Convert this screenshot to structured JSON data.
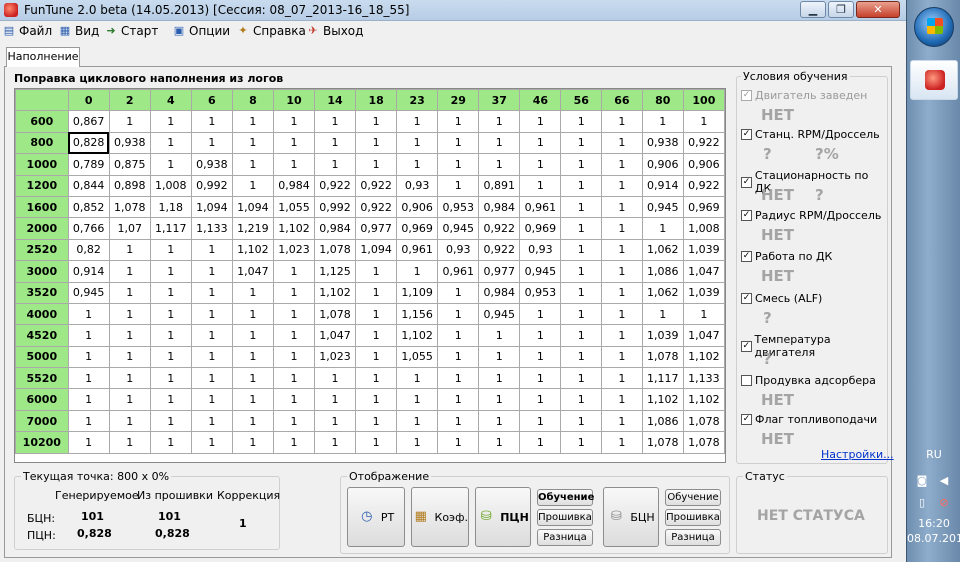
{
  "window": {
    "title": "FunTune 2.0 beta (14.05.2013) [Сессия: 08_07_2013-16_18_55]",
    "min": "▁",
    "max": "❐",
    "close": "✕"
  },
  "menu": [
    {
      "label": "Файл",
      "icon": "file-icon"
    },
    {
      "label": "Вид",
      "icon": "view-icon"
    },
    {
      "label": "Старт",
      "icon": "start-icon"
    },
    {
      "label": "Опции",
      "icon": "options-icon"
    },
    {
      "label": "Справка",
      "icon": "help-icon"
    },
    {
      "label": "Выход",
      "icon": "exit-icon"
    }
  ],
  "tab": "Наполнение",
  "grid": {
    "title": "Поправка циклового наполнения из логов",
    "columns": [
      "0",
      "2",
      "4",
      "6",
      "8",
      "10",
      "14",
      "18",
      "23",
      "29",
      "37",
      "46",
      "56",
      "66",
      "80",
      "100"
    ],
    "rows": [
      {
        "rpm": "600",
        "v": [
          "0,867",
          "1",
          "1",
          "1",
          "1",
          "1",
          "1",
          "1",
          "1",
          "1",
          "1",
          "1",
          "1",
          "1",
          "1",
          "1"
        ]
      },
      {
        "rpm": "800",
        "v": [
          "0,828",
          "0,938",
          "1",
          "1",
          "1",
          "1",
          "1",
          "1",
          "1",
          "1",
          "1",
          "1",
          "1",
          "1",
          "0,938",
          "0,922"
        ]
      },
      {
        "rpm": "1000",
        "v": [
          "0,789",
          "0,875",
          "1",
          "0,938",
          "1",
          "1",
          "1",
          "1",
          "1",
          "1",
          "1",
          "1",
          "1",
          "1",
          "0,906",
          "0,906"
        ]
      },
      {
        "rpm": "1200",
        "v": [
          "0,844",
          "0,898",
          "1,008",
          "0,992",
          "1",
          "0,984",
          "0,922",
          "0,922",
          "0,93",
          "1",
          "0,891",
          "1",
          "1",
          "1",
          "0,914",
          "0,922"
        ]
      },
      {
        "rpm": "1600",
        "v": [
          "0,852",
          "1,078",
          "1,18",
          "1,094",
          "1,094",
          "1,055",
          "0,992",
          "0,922",
          "0,906",
          "0,953",
          "0,984",
          "0,961",
          "1",
          "1",
          "0,945",
          "0,969"
        ]
      },
      {
        "rpm": "2000",
        "v": [
          "0,766",
          "1,07",
          "1,117",
          "1,133",
          "1,219",
          "1,102",
          "0,984",
          "0,977",
          "0,969",
          "0,945",
          "0,922",
          "0,969",
          "1",
          "1",
          "1",
          "1,008"
        ]
      },
      {
        "rpm": "2520",
        "v": [
          "0,82",
          "1",
          "1",
          "1",
          "1,102",
          "1,023",
          "1,078",
          "1,094",
          "0,961",
          "0,93",
          "0,922",
          "0,93",
          "1",
          "1",
          "1,062",
          "1,039"
        ]
      },
      {
        "rpm": "3000",
        "v": [
          "0,914",
          "1",
          "1",
          "1",
          "1,047",
          "1",
          "1,125",
          "1",
          "1",
          "0,961",
          "0,977",
          "0,945",
          "1",
          "1",
          "1,086",
          "1,047"
        ]
      },
      {
        "rpm": "3520",
        "v": [
          "0,945",
          "1",
          "1",
          "1",
          "1",
          "1",
          "1,102",
          "1",
          "1,109",
          "1",
          "0,984",
          "0,953",
          "1",
          "1",
          "1,062",
          "1,039"
        ]
      },
      {
        "rpm": "4000",
        "v": [
          "1",
          "1",
          "1",
          "1",
          "1",
          "1",
          "1,078",
          "1",
          "1,156",
          "1",
          "0,945",
          "1",
          "1",
          "1",
          "1",
          "1"
        ]
      },
      {
        "rpm": "4520",
        "v": [
          "1",
          "1",
          "1",
          "1",
          "1",
          "1",
          "1,047",
          "1",
          "1,102",
          "1",
          "1",
          "1",
          "1",
          "1",
          "1,039",
          "1,047"
        ]
      },
      {
        "rpm": "5000",
        "v": [
          "1",
          "1",
          "1",
          "1",
          "1",
          "1",
          "1,023",
          "1",
          "1,055",
          "1",
          "1",
          "1",
          "1",
          "1",
          "1,078",
          "1,102"
        ]
      },
      {
        "rpm": "5520",
        "v": [
          "1",
          "1",
          "1",
          "1",
          "1",
          "1",
          "1",
          "1",
          "1",
          "1",
          "1",
          "1",
          "1",
          "1",
          "1,117",
          "1,133"
        ]
      },
      {
        "rpm": "6000",
        "v": [
          "1",
          "1",
          "1",
          "1",
          "1",
          "1",
          "1",
          "1",
          "1",
          "1",
          "1",
          "1",
          "1",
          "1",
          "1,102",
          "1,102"
        ]
      },
      {
        "rpm": "7000",
        "v": [
          "1",
          "1",
          "1",
          "1",
          "1",
          "1",
          "1",
          "1",
          "1",
          "1",
          "1",
          "1",
          "1",
          "1",
          "1,086",
          "1,078"
        ]
      },
      {
        "rpm": "10200",
        "v": [
          "1",
          "1",
          "1",
          "1",
          "1",
          "1",
          "1",
          "1",
          "1",
          "1",
          "1",
          "1",
          "1",
          "1",
          "1,078",
          "1,078"
        ]
      }
    ]
  },
  "conditions": {
    "title": "Условия обучения",
    "items": [
      {
        "label": "Двигатель заведен",
        "checked": true,
        "disabled": true,
        "value": "НЕТ"
      },
      {
        "label": "Станц. RPM/Дроссель",
        "checked": true,
        "disabled": false,
        "value": "?",
        "value2": "?%"
      },
      {
        "label": "Стационарность по ДК",
        "checked": true,
        "disabled": false,
        "value": "НЕТ",
        "value2": "?"
      },
      {
        "label": "Радиус RPM/Дроссель",
        "checked": true,
        "disabled": false,
        "value": "НЕТ"
      },
      {
        "label": "Работа по ДК",
        "checked": true,
        "disabled": false,
        "value": "НЕТ"
      },
      {
        "label": "Смесь (ALF)",
        "checked": true,
        "disabled": false,
        "value": "?"
      },
      {
        "label": "Температура двигателя",
        "checked": true,
        "disabled": false,
        "value": "?"
      },
      {
        "label": "Продувка адсорбера",
        "checked": false,
        "disabled": false,
        "value": "НЕТ"
      },
      {
        "label": "Флаг топливоподачи",
        "checked": true,
        "disabled": false,
        "value": "НЕТ"
      }
    ],
    "settings_link": "Настройки..."
  },
  "point": {
    "title": "Текущая точка: 800 x 0%",
    "col_generated": "Генерируемое",
    "col_firmware": "Из прошивки",
    "col_correction": "Коррекция",
    "row1_label": "БЦН:",
    "row1_gen": "101",
    "row1_fw": "101",
    "row2_label": "ПЦН:",
    "row2_gen": "0,828",
    "row2_fw": "0,828",
    "correction": "1"
  },
  "display": {
    "title": "Отображение",
    "btn_rt": "РТ",
    "btn_koef": "Коэф.",
    "btn_pcn": "ПЦН",
    "btn_bcn": "БЦН",
    "left_small": [
      "Обучение",
      "Прошивка",
      "Разница"
    ],
    "right_small": [
      "Обучение",
      "Прошивка",
      "Разница"
    ]
  },
  "status": {
    "title": "Статус",
    "value": "НЕТ СТАТУСА"
  },
  "taskbar": {
    "lang": "RU",
    "time": "16:20",
    "date": "08.07.2013"
  }
}
